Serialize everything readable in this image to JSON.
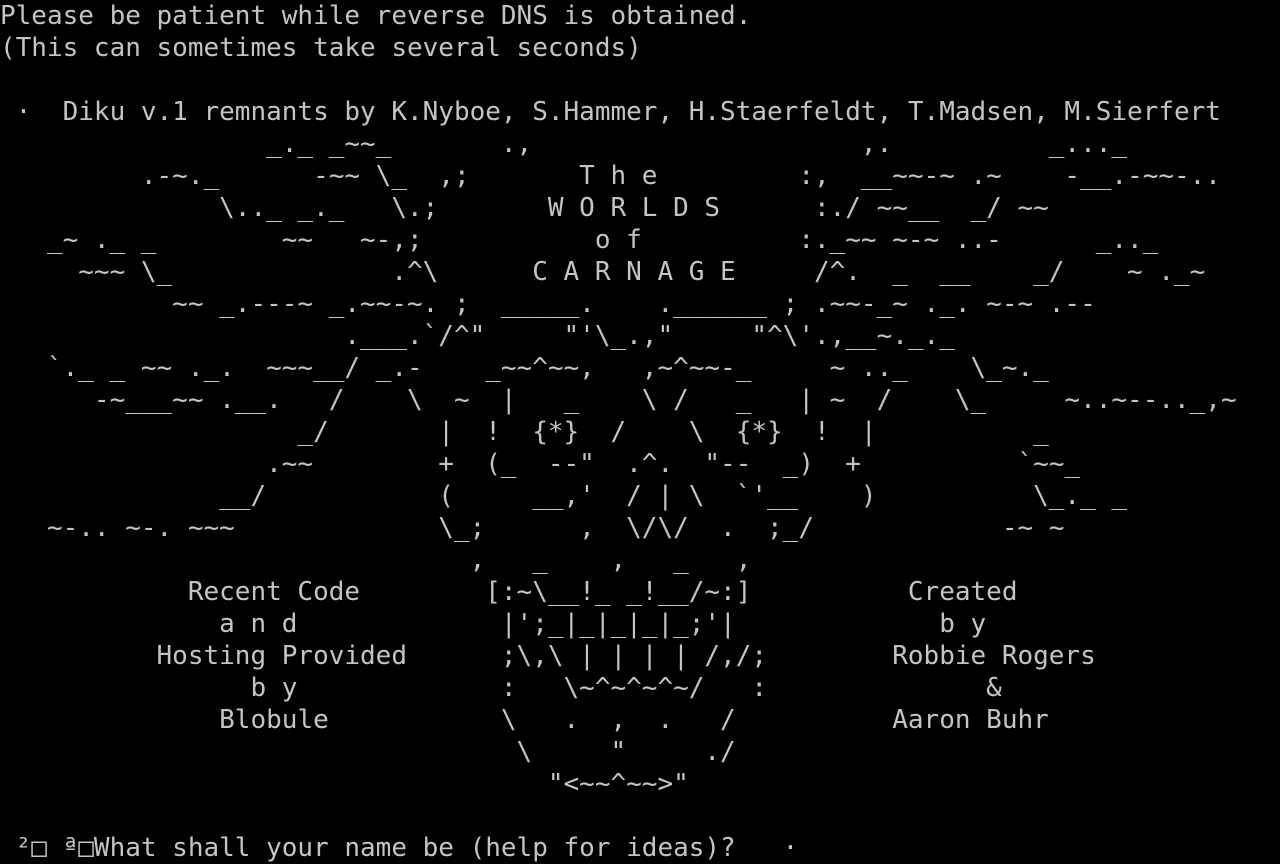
{
  "terminal": {
    "lines": [
      "Please be patient while reverse DNS is obtained.",
      "(This can sometimes take several seconds)",
      "",
      " ·  Diku v.1 remnants by K.Nyboe, S.Hammer, H.Staerfeldt, T.Madsen, M.Sierfert",
      "                 _._ _~~_       .,                     ,.          _..._",
      "         .-~._      -~~ \\_  ,;       T h e         :,  __~~-~ .~    -__.-~~-..",
      "              \\.._ _._   \\.;       W O R L D S      :./ ~~__  _/ ~~",
      "   _~ ._ _        ~~   ~-,;           o f          :._~~ ~-~ ..-      _.._",
      "     ~~~ \\_              .^\\      C A R N A G E     /^.  _  __    _/    ~ ._~",
      "           ~~ _.---~ _.~~-~. ;  _____.    .______ ; .~~-_~ ._. ~-~ .--",
      "                      .___.`/^\"     \"'\\_.,\"     \"^\\'.,__~._._",
      "   `._ _ ~~ ._.  ~~~__/ _.-    _~~^~~,   ,~^~~-_     ~ .._    \\_~._",
      "      -~___~~ .__.   /    \\  ~  |   _    \\ /   _   | ~  /    \\_     ~..~--.._,~",
      "                   _/       |  !  {*}  /    \\  {*}  !  |          _",
      "                 .~~        +  (_  --\"  .^.  \"--  _)  +          `~~_",
      "              __/           (     __,'  / | \\  `'__    )          \\_._ _",
      "   ~-.. ~-. ~~~             \\_;      ,  \\/\\/  .  ;_/            -~ ~",
      "                              ,   _    ,   _   ,",
      "            Recent Code        [:~\\__!_ _!__/~:]          Created",
      "              a n d             |';_|_|_|_|_;'|             b y",
      "          Hosting Provided      ;\\,\\ | | | | /,/;        Robbie Rogers",
      "                b y             :   \\~^~^~^~/   :              &",
      "              Blobule           \\   .  ,  .   /          Aaron Buhr",
      "                                 \\     \"     ./",
      "                                   \"<~~^~~>\"",
      "",
      " ²□ ª□What shall your name be (help for ideas)?   ·"
    ]
  }
}
